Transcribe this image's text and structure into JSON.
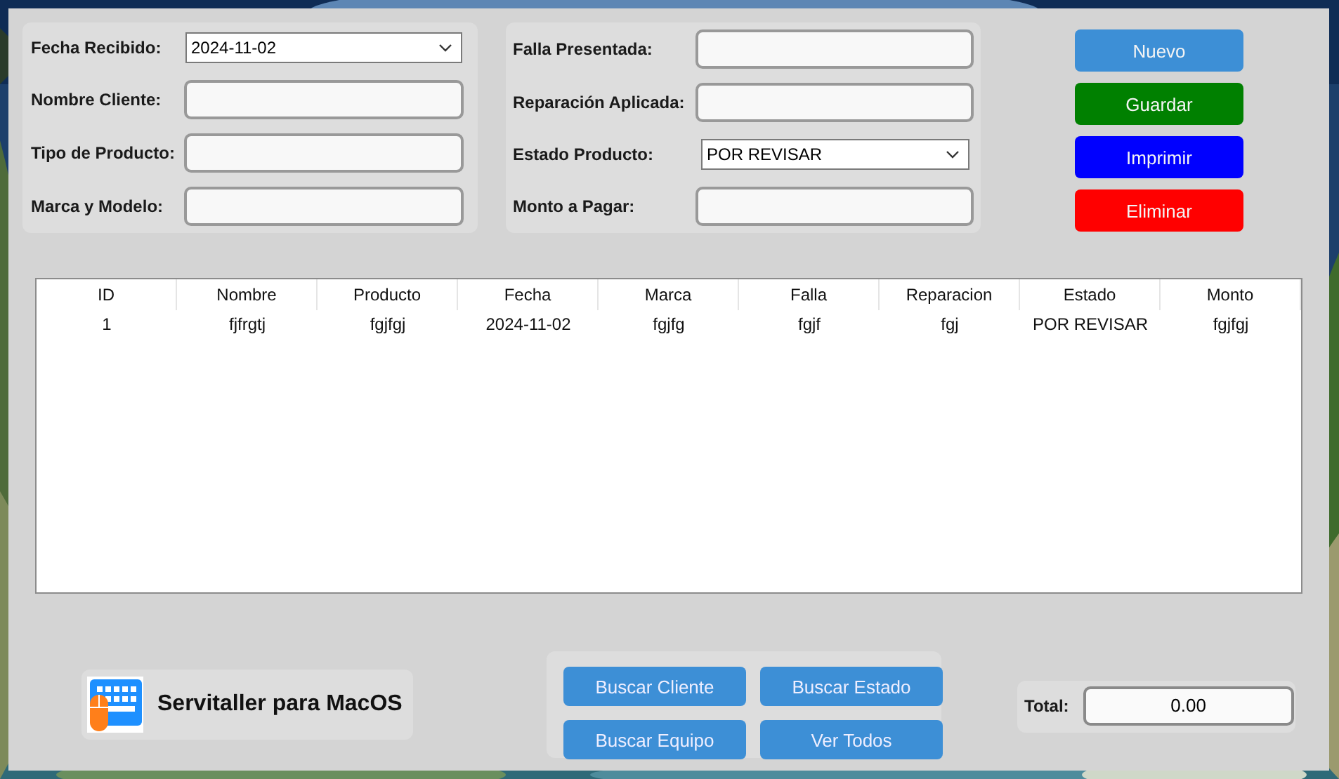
{
  "form_left": [
    {
      "label": "Fecha Recibido:",
      "kind": "select",
      "value": "2024-11-02"
    },
    {
      "label": "Nombre Cliente:",
      "kind": "text"
    },
    {
      "label": "Tipo de Producto:",
      "kind": "text"
    },
    {
      "label": "Marca y Modelo:",
      "kind": "text"
    }
  ],
  "form_right": [
    {
      "label": "Falla Presentada:",
      "kind": "text"
    },
    {
      "label": "Reparación Aplicada:",
      "kind": "text"
    },
    {
      "label": "Estado Producto:",
      "kind": "select",
      "value": "POR REVISAR"
    },
    {
      "label": "Monto a Pagar:",
      "kind": "text"
    }
  ],
  "actions": [
    {
      "label": "Nuevo",
      "color": "#3d8fd6"
    },
    {
      "label": "Guardar",
      "color": "#008000"
    },
    {
      "label": "Imprimir",
      "color": "#0000ff"
    },
    {
      "label": "Eliminar",
      "color": "#ff0000"
    }
  ],
  "table": {
    "columns": [
      "ID",
      "Nombre",
      "Producto",
      "Fecha",
      "Marca",
      "Falla",
      "Reparacion",
      "Estado",
      "Monto"
    ],
    "rows": [
      [
        "1",
        "fjfrgtj",
        "fgjfgj",
        "2024-11-02",
        "fgjfg",
        "fgjf",
        "fgj",
        "POR REVISAR",
        "fgjfgj"
      ]
    ]
  },
  "app_title": "Servitaller para MacOS",
  "search_buttons": [
    "Buscar Cliente",
    "Buscar Estado",
    "Buscar Equipo",
    "Ver Todos"
  ],
  "total": {
    "label": "Total:",
    "value": "0.00"
  }
}
